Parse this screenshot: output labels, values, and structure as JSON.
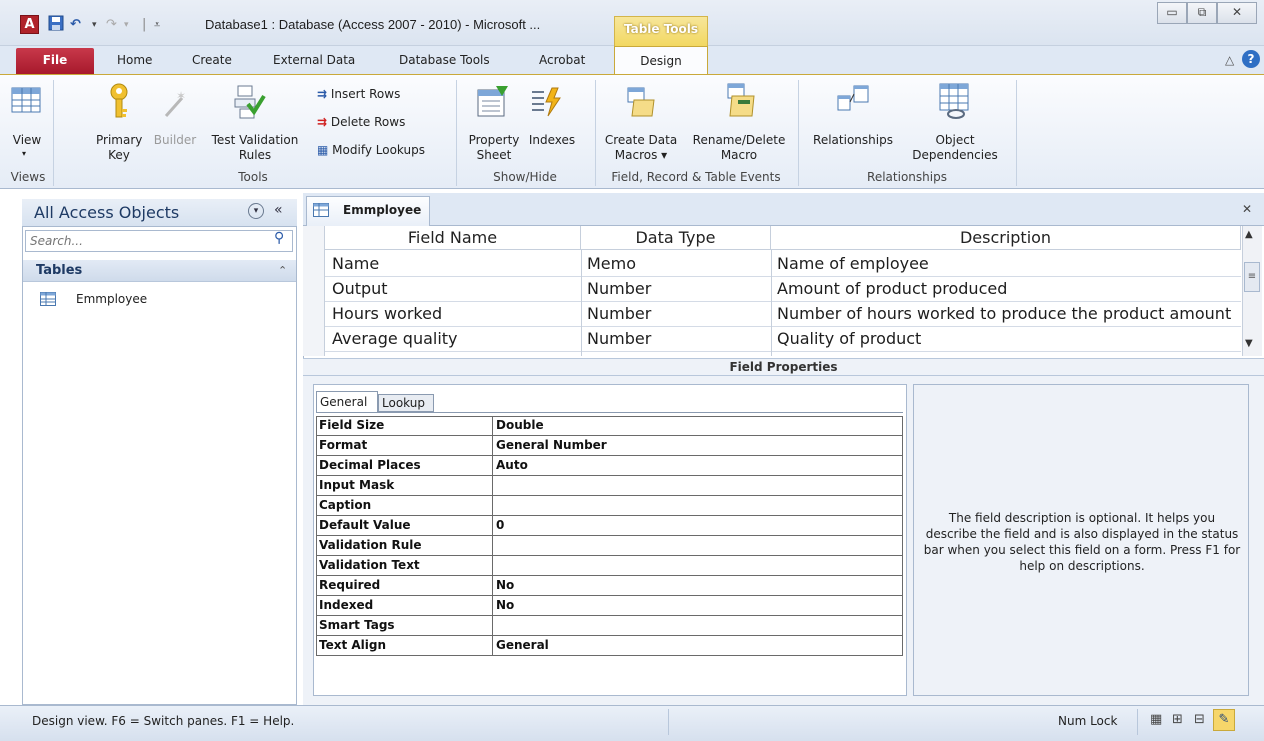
{
  "window": {
    "title": "Database1 : Database (Access 2007 - 2010)  -  Microsoft ...",
    "context_tab": "Table Tools",
    "min_glyph": "▭",
    "restore_glyph": "⧉",
    "close_glyph": "✕"
  },
  "ribbon_tabs": [
    "File",
    "Home",
    "Create",
    "External Data",
    "Database Tools",
    "Acrobat",
    "Design"
  ],
  "ribbon": {
    "views": {
      "label": "Views",
      "view_button": "View"
    },
    "tools": {
      "label": "Tools",
      "primary_key": [
        "Primary",
        "Key"
      ],
      "builder": "Builder",
      "test_validation": [
        "Test Validation",
        "Rules"
      ],
      "insert_rows": "Insert Rows",
      "delete_rows": "Delete Rows",
      "modify_lookups": "Modify Lookups"
    },
    "showhide": {
      "label": "Show/Hide",
      "property_sheet": [
        "Property",
        "Sheet"
      ],
      "indexes": "Indexes"
    },
    "events": {
      "label": "Field, Record & Table Events",
      "create_data_macros": [
        "Create Data",
        "Macros ▾"
      ],
      "rename_delete": [
        "Rename/Delete",
        "Macro"
      ]
    },
    "relationships": {
      "label": "Relationships",
      "relationships": "Relationships",
      "object_dependencies": [
        "Object",
        "Dependencies"
      ]
    }
  },
  "nav": {
    "title": "All Access Objects",
    "search_placeholder": "Search...",
    "section": "Tables",
    "items": [
      "Emmployee"
    ]
  },
  "document": {
    "tab": "Emmployee",
    "columns": [
      "Field Name",
      "Data Type",
      "Description"
    ],
    "rows": [
      {
        "field": "Name",
        "type": "Memo",
        "desc": "Name of employee"
      },
      {
        "field": "Output",
        "type": "Number",
        "desc": "Amount of product produced"
      },
      {
        "field": "Hours worked",
        "type": "Number",
        "desc": "Number of hours worked to produce the product amount"
      },
      {
        "field": "Average quality",
        "type": "Number",
        "desc": "Quality of product"
      }
    ],
    "field_properties_title": "Field Properties",
    "prop_tabs": [
      "General",
      "Lookup"
    ],
    "properties": [
      {
        "name": "Field Size",
        "value": "Double"
      },
      {
        "name": "Format",
        "value": "General Number"
      },
      {
        "name": "Decimal Places",
        "value": "Auto"
      },
      {
        "name": "Input Mask",
        "value": ""
      },
      {
        "name": "Caption",
        "value": ""
      },
      {
        "name": "Default Value",
        "value": "0"
      },
      {
        "name": "Validation Rule",
        "value": ""
      },
      {
        "name": "Validation Text",
        "value": ""
      },
      {
        "name": "Required",
        "value": "No"
      },
      {
        "name": "Indexed",
        "value": "No"
      },
      {
        "name": "Smart Tags",
        "value": ""
      },
      {
        "name": "Text Align",
        "value": "General"
      }
    ],
    "help_text": "The field description is optional. It helps you describe the field and is also displayed in the status bar when you select this field on a form. Press F1 for help on descriptions."
  },
  "status": {
    "left": "Design view.  F6 = Switch panes.  F1 = Help.",
    "num_lock": "Num Lock"
  }
}
